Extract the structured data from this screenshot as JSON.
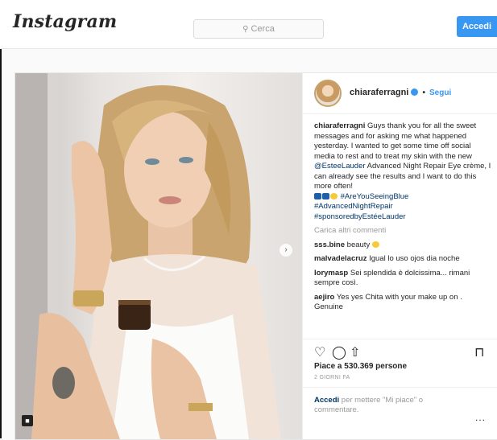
{
  "header": {
    "logo": "Instagram",
    "search_placeholder": "Cerca",
    "login_button": "Accedi"
  },
  "post": {
    "username": "chiaraferragni",
    "follow": "Segui",
    "separator": "•",
    "caption": {
      "author": "chiaraferragni",
      "text": "Guys thank you for all the sweet messages and for asking me what happened yesterday. I wanted to get some time off social media to rest and to treat my skin with the new",
      "mention": "@EsteeLauder",
      "text2": "Advanced Night Repair Eye crème, I can already see the results and I want to do this more often!",
      "hashtags": [
        "#AreYouSeeingBlue",
        "#AdvancedNightRepair",
        "#sponsoredbyEstéeLauder"
      ]
    },
    "load_more": "Carica altri commenti",
    "comments": [
      {
        "user": "sss.bine",
        "text": "beauty"
      },
      {
        "user": "malvadelacruz",
        "text": "Igual lo uso ojos dia noche"
      },
      {
        "user": "lorymasp",
        "text": "Sei splendida è dolcissima... rimani sempre così."
      },
      {
        "user": "aejiro",
        "text": "Yes yes Chita with your make up on . Genuine"
      }
    ],
    "likes": "Piace a 530.369 persone",
    "time": "2 GIORNI FA",
    "login_prompt": {
      "link": "Accedi",
      "text": "per mettere \"Mi piace\" o commentare."
    },
    "more_options": "..."
  },
  "icons": {
    "heart": "heart-icon",
    "comment": "comment-icon",
    "share": "share-icon",
    "bookmark": "bookmark-icon",
    "search": "search-icon"
  },
  "colors": {
    "accent": "#3897f0",
    "link": "#003569"
  }
}
